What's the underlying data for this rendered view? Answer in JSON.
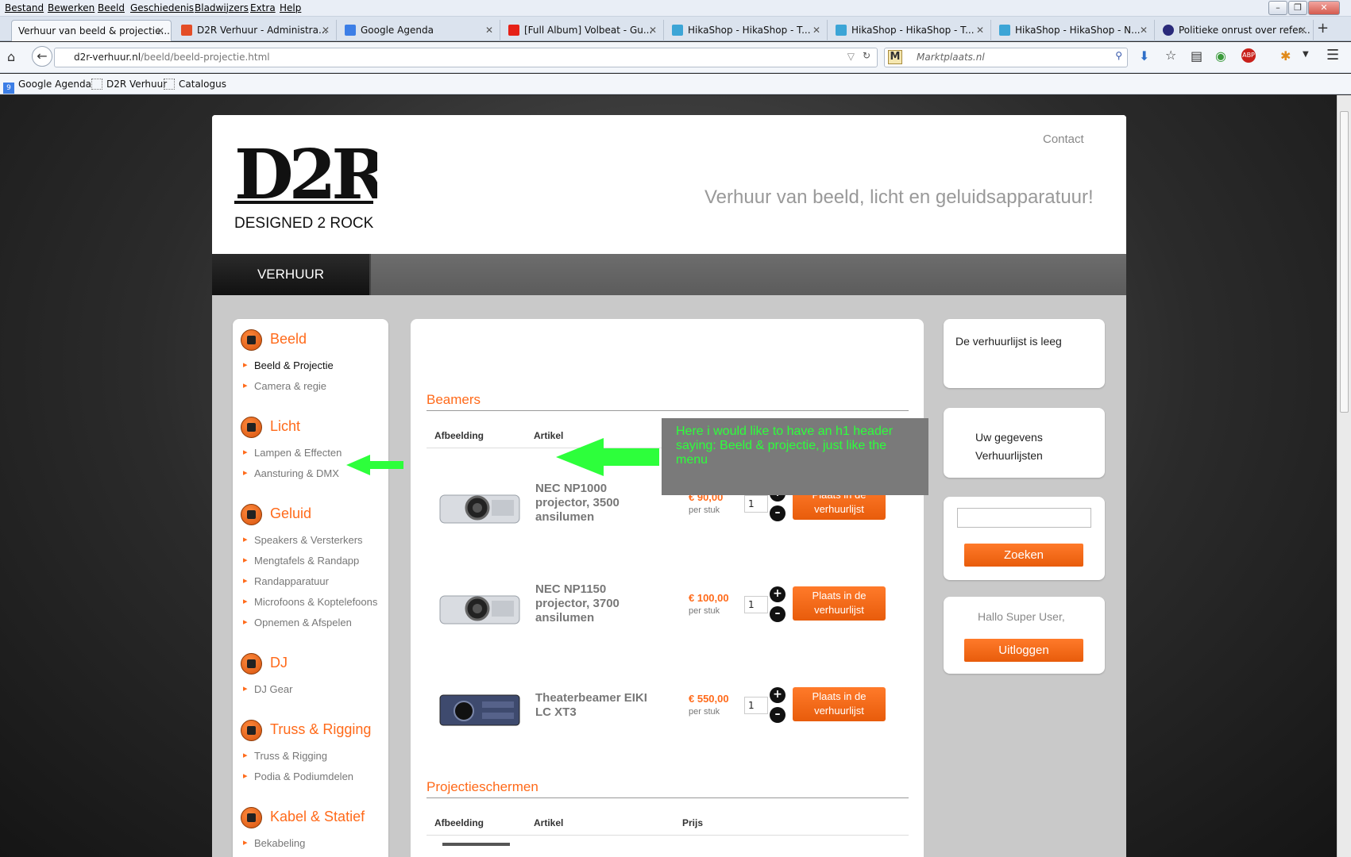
{
  "browser": {
    "menu": [
      "Bestand",
      "Bewerken",
      "Beeld",
      "Geschiedenis",
      "Bladwijzers",
      "Extra",
      "Help"
    ],
    "tabs": [
      {
        "label": "Verhuur van beeld & projectie...",
        "icon": "d2r-favicon",
        "color": "#ffffff"
      },
      {
        "label": "D2R Verhuur - Administra...",
        "icon": "joomla-favicon",
        "color": "#e44d26"
      },
      {
        "label": "Google Agenda",
        "icon": "google-calendar-favicon",
        "color": "#3c7ee6"
      },
      {
        "label": "[Full Album] Volbeat - Gu...",
        "icon": "youtube-favicon",
        "color": "#e62117"
      },
      {
        "label": "HikaShop - HikaShop - T...",
        "icon": "hikashop-favicon",
        "color": "#3ca5d6"
      },
      {
        "label": "HikaShop - HikaShop - T...",
        "icon": "hikashop-favicon",
        "color": "#3ca5d6"
      },
      {
        "label": "HikaShop - HikaShop - N...",
        "icon": "hikashop-favicon",
        "color": "#3ca5d6"
      },
      {
        "label": "Politieke onrust over refer...",
        "icon": "nos-favicon",
        "color": "#2a2a7a"
      }
    ],
    "url_domain": "d2r-verhuur.nl",
    "url_path": "/beeld/beeld-projectie.html",
    "search_placeholder": "Marktplaats.nl",
    "search_logo": "M",
    "bookmarks": [
      "Google Agenda",
      "D2R Verhuur",
      "Catalogus"
    ],
    "bookmark_badge": "9"
  },
  "site": {
    "logo_text": "D2R",
    "logo_sub": "DESIGNED 2 ROCK",
    "contact": "Contact",
    "tagline": "Verhuur van beeld, licht en geluidsapparatuur!",
    "nav_item": "VERHUUR",
    "brand_color": "#ff6a1a"
  },
  "sidebar": {
    "categories": [
      {
        "title": "Beeld",
        "icon": "projector-icon",
        "items": [
          "Beeld & Projectie",
          "Camera & regie"
        ]
      },
      {
        "title": "Licht",
        "icon": "light-icon",
        "items": [
          "Lampen & Effecten",
          "Aansturing & DMX"
        ]
      },
      {
        "title": "Geluid",
        "icon": "microphone-icon",
        "items": [
          "Speakers & Versterkers",
          "Mengtafels & Randapp",
          "Randapparatuur",
          "Microfoons & Koptelefoons",
          "Opnemen & Afspelen"
        ]
      },
      {
        "title": "DJ",
        "icon": "dj-icon",
        "items": [
          "DJ Gear"
        ]
      },
      {
        "title": "Truss & Rigging",
        "icon": "truss-icon",
        "items": [
          "Truss & Rigging",
          "Podia & Podiumdelen"
        ]
      },
      {
        "title": "Kabel & Statief",
        "icon": "cable-icon",
        "items": [
          "Bekabeling"
        ]
      }
    ]
  },
  "annotation": {
    "text": "Here i would like to have an h1 header saying: Beeld & projectie,  just like the menu"
  },
  "products": {
    "section1": "Beamers",
    "section2": "Projectieschermen",
    "columns": [
      "Afbeelding",
      "Artikel",
      "Prijs"
    ],
    "unit": "per stuk",
    "add_label": "Plaats in de verhuurlijst",
    "items": [
      {
        "name": "NEC NP1000 projector, 3500 ansilumen",
        "price": "€ 90,00",
        "qty": "1"
      },
      {
        "name": "NEC NP1150 projector, 3700 ansilumen",
        "price": "€ 100,00",
        "qty": "1"
      },
      {
        "name": "Theaterbeamer EIKI LC XT3",
        "price": "€ 550,00",
        "qty": "1"
      }
    ]
  },
  "right": {
    "cart_empty": "De verhuurlijst is leeg",
    "account_line1": "Uw gegevens",
    "account_line2": "Verhuurlijsten",
    "search_button": "Zoeken",
    "greeting": "Hallo Super User,",
    "logout": "Uitloggen"
  }
}
